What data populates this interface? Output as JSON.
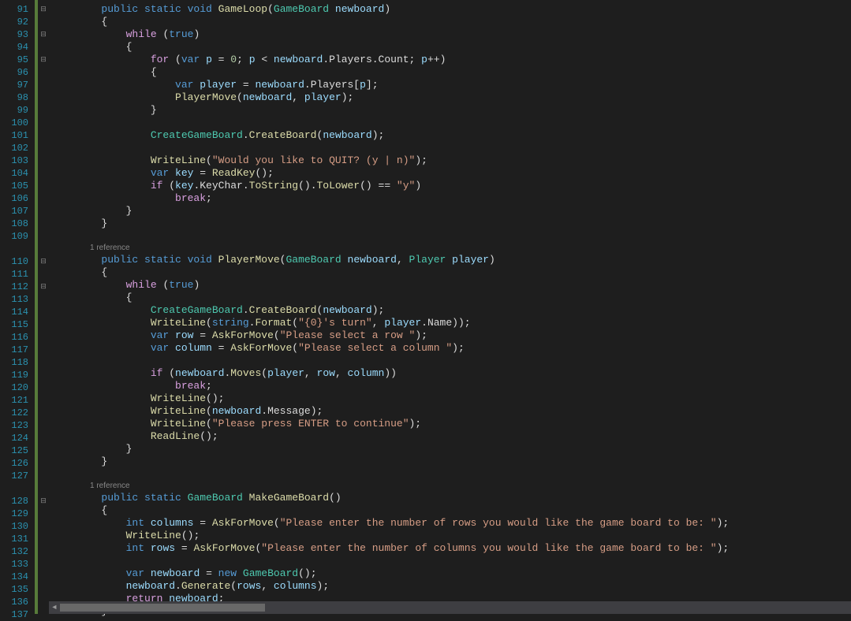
{
  "codelens": {
    "text": "1 reference"
  },
  "lines": {
    "91": {
      "tokens": [
        [
          "kw",
          "        public static void"
        ],
        [
          "plain",
          " "
        ],
        [
          "method",
          "GameLoop"
        ],
        [
          "plain",
          "("
        ],
        [
          "type",
          "GameBoard"
        ],
        [
          "plain",
          " "
        ],
        [
          "param",
          "newboard"
        ],
        [
          "plain",
          ")"
        ]
      ]
    },
    "92": {
      "tokens": [
        [
          "plain",
          "        {"
        ]
      ]
    },
    "93": {
      "tokens": [
        [
          "plain",
          "            "
        ],
        [
          "ctrl",
          "while"
        ],
        [
          "plain",
          " ("
        ],
        [
          "kw",
          "true"
        ],
        [
          "plain",
          ")"
        ]
      ]
    },
    "94": {
      "tokens": [
        [
          "plain",
          "            {"
        ]
      ]
    },
    "95": {
      "tokens": [
        [
          "plain",
          "                "
        ],
        [
          "ctrl",
          "for"
        ],
        [
          "plain",
          " ("
        ],
        [
          "kw",
          "var"
        ],
        [
          "plain",
          " "
        ],
        [
          "param",
          "p"
        ],
        [
          "plain",
          " = "
        ],
        [
          "num",
          "0"
        ],
        [
          "plain",
          "; "
        ],
        [
          "param",
          "p"
        ],
        [
          "plain",
          " < "
        ],
        [
          "param",
          "newboard"
        ],
        [
          "plain",
          ".Players.Count; "
        ],
        [
          "param",
          "p"
        ],
        [
          "plain",
          "++)"
        ]
      ]
    },
    "96": {
      "tokens": [
        [
          "plain",
          "                {"
        ]
      ]
    },
    "97": {
      "tokens": [
        [
          "plain",
          "                    "
        ],
        [
          "kw",
          "var"
        ],
        [
          "plain",
          " "
        ],
        [
          "param",
          "player"
        ],
        [
          "plain",
          " = "
        ],
        [
          "param",
          "newboard"
        ],
        [
          "plain",
          ".Players["
        ],
        [
          "param",
          "p"
        ],
        [
          "plain",
          "];"
        ]
      ]
    },
    "98": {
      "tokens": [
        [
          "plain",
          "                    "
        ],
        [
          "method",
          "PlayerMove"
        ],
        [
          "plain",
          "("
        ],
        [
          "param",
          "newboard"
        ],
        [
          "plain",
          ", "
        ],
        [
          "param",
          "player"
        ],
        [
          "plain",
          ");"
        ]
      ]
    },
    "99": {
      "tokens": [
        [
          "plain",
          "                }"
        ]
      ]
    },
    "100": {
      "tokens": [
        [
          "plain",
          ""
        ]
      ]
    },
    "101": {
      "tokens": [
        [
          "plain",
          "                "
        ],
        [
          "type",
          "CreateGameBoard"
        ],
        [
          "plain",
          "."
        ],
        [
          "method",
          "CreateBoard"
        ],
        [
          "plain",
          "("
        ],
        [
          "param",
          "newboard"
        ],
        [
          "plain",
          ");"
        ]
      ]
    },
    "102": {
      "tokens": [
        [
          "plain",
          ""
        ]
      ]
    },
    "103": {
      "tokens": [
        [
          "plain",
          "                "
        ],
        [
          "method",
          "WriteLine"
        ],
        [
          "plain",
          "("
        ],
        [
          "str",
          "\"Would you like to QUIT? (y | n)\""
        ],
        [
          "plain",
          ");"
        ]
      ]
    },
    "104": {
      "tokens": [
        [
          "plain",
          "                "
        ],
        [
          "kw",
          "var"
        ],
        [
          "plain",
          " "
        ],
        [
          "param",
          "key"
        ],
        [
          "plain",
          " = "
        ],
        [
          "method",
          "ReadKey"
        ],
        [
          "plain",
          "();"
        ]
      ]
    },
    "105": {
      "tokens": [
        [
          "plain",
          "                "
        ],
        [
          "ctrl",
          "if"
        ],
        [
          "plain",
          " ("
        ],
        [
          "param",
          "key"
        ],
        [
          "plain",
          ".KeyChar."
        ],
        [
          "method",
          "ToString"
        ],
        [
          "plain",
          "()."
        ],
        [
          "method",
          "ToLower"
        ],
        [
          "plain",
          "() == "
        ],
        [
          "str",
          "\"y\""
        ],
        [
          "plain",
          ")"
        ]
      ]
    },
    "106": {
      "tokens": [
        [
          "plain",
          "                    "
        ],
        [
          "ctrl",
          "break"
        ],
        [
          "plain",
          ";"
        ]
      ]
    },
    "107": {
      "tokens": [
        [
          "plain",
          "            }"
        ]
      ]
    },
    "108": {
      "tokens": [
        [
          "plain",
          "        }"
        ]
      ]
    },
    "109": {
      "tokens": [
        [
          "plain",
          ""
        ]
      ]
    },
    "110": {
      "tokens": [
        [
          "kw",
          "        public static void"
        ],
        [
          "plain",
          " "
        ],
        [
          "method",
          "PlayerMove"
        ],
        [
          "plain",
          "("
        ],
        [
          "type",
          "GameBoard"
        ],
        [
          "plain",
          " "
        ],
        [
          "param",
          "newboard"
        ],
        [
          "plain",
          ", "
        ],
        [
          "type",
          "Player"
        ],
        [
          "plain",
          " "
        ],
        [
          "param",
          "player"
        ],
        [
          "plain",
          ")"
        ]
      ]
    },
    "111": {
      "tokens": [
        [
          "plain",
          "        {"
        ]
      ]
    },
    "112": {
      "tokens": [
        [
          "plain",
          "            "
        ],
        [
          "ctrl",
          "while"
        ],
        [
          "plain",
          " ("
        ],
        [
          "kw",
          "true"
        ],
        [
          "plain",
          ")"
        ]
      ]
    },
    "113": {
      "tokens": [
        [
          "plain",
          "            {"
        ]
      ]
    },
    "114": {
      "tokens": [
        [
          "plain",
          "                "
        ],
        [
          "type",
          "CreateGameBoard"
        ],
        [
          "plain",
          "."
        ],
        [
          "method",
          "CreateBoard"
        ],
        [
          "plain",
          "("
        ],
        [
          "param",
          "newboard"
        ],
        [
          "plain",
          ");"
        ]
      ]
    },
    "115": {
      "tokens": [
        [
          "plain",
          "                "
        ],
        [
          "method",
          "WriteLine"
        ],
        [
          "plain",
          "("
        ],
        [
          "kw",
          "string"
        ],
        [
          "plain",
          "."
        ],
        [
          "method",
          "Format"
        ],
        [
          "plain",
          "("
        ],
        [
          "str",
          "\"{0}'s turn\""
        ],
        [
          "plain",
          ", "
        ],
        [
          "param",
          "player"
        ],
        [
          "plain",
          ".Name));"
        ]
      ]
    },
    "116": {
      "tokens": [
        [
          "plain",
          "                "
        ],
        [
          "kw",
          "var"
        ],
        [
          "plain",
          " "
        ],
        [
          "param",
          "row"
        ],
        [
          "plain",
          " = "
        ],
        [
          "method",
          "AskForMove"
        ],
        [
          "plain",
          "("
        ],
        [
          "str",
          "\"Please select a row \""
        ],
        [
          "plain",
          ");"
        ]
      ]
    },
    "117": {
      "tokens": [
        [
          "plain",
          "                "
        ],
        [
          "kw",
          "var"
        ],
        [
          "plain",
          " "
        ],
        [
          "param",
          "column"
        ],
        [
          "plain",
          " = "
        ],
        [
          "method",
          "AskForMove"
        ],
        [
          "plain",
          "("
        ],
        [
          "str",
          "\"Please select a column \""
        ],
        [
          "plain",
          ");"
        ]
      ]
    },
    "118": {
      "tokens": [
        [
          "plain",
          ""
        ]
      ]
    },
    "119": {
      "tokens": [
        [
          "plain",
          "                "
        ],
        [
          "ctrl",
          "if"
        ],
        [
          "plain",
          " ("
        ],
        [
          "param",
          "newboard"
        ],
        [
          "plain",
          "."
        ],
        [
          "method",
          "Moves"
        ],
        [
          "plain",
          "("
        ],
        [
          "param",
          "player"
        ],
        [
          "plain",
          ", "
        ],
        [
          "param",
          "row"
        ],
        [
          "plain",
          ", "
        ],
        [
          "param",
          "column"
        ],
        [
          "plain",
          "))"
        ]
      ]
    },
    "120": {
      "tokens": [
        [
          "plain",
          "                    "
        ],
        [
          "ctrl",
          "break"
        ],
        [
          "plain",
          ";"
        ]
      ]
    },
    "121": {
      "tokens": [
        [
          "plain",
          "                "
        ],
        [
          "method",
          "WriteLine"
        ],
        [
          "plain",
          "();"
        ]
      ]
    },
    "122": {
      "tokens": [
        [
          "plain",
          "                "
        ],
        [
          "method",
          "WriteLine"
        ],
        [
          "plain",
          "("
        ],
        [
          "param",
          "newboard"
        ],
        [
          "plain",
          ".Message);"
        ]
      ]
    },
    "123": {
      "tokens": [
        [
          "plain",
          "                "
        ],
        [
          "method",
          "WriteLine"
        ],
        [
          "plain",
          "("
        ],
        [
          "str",
          "\"Please press ENTER to continue\""
        ],
        [
          "plain",
          ");"
        ]
      ]
    },
    "124": {
      "tokens": [
        [
          "plain",
          "                "
        ],
        [
          "method",
          "ReadLine"
        ],
        [
          "plain",
          "();"
        ]
      ]
    },
    "125": {
      "tokens": [
        [
          "plain",
          "            }"
        ]
      ]
    },
    "126": {
      "tokens": [
        [
          "plain",
          "        }"
        ]
      ]
    },
    "127": {
      "tokens": [
        [
          "plain",
          ""
        ]
      ]
    },
    "128": {
      "tokens": [
        [
          "kw",
          "        public static"
        ],
        [
          "plain",
          " "
        ],
        [
          "type",
          "GameBoard"
        ],
        [
          "plain",
          " "
        ],
        [
          "method",
          "MakeGameBoard"
        ],
        [
          "plain",
          "()"
        ]
      ]
    },
    "129": {
      "tokens": [
        [
          "plain",
          "        {"
        ]
      ]
    },
    "130": {
      "tokens": [
        [
          "plain",
          "            "
        ],
        [
          "kw",
          "int"
        ],
        [
          "plain",
          " "
        ],
        [
          "param",
          "columns"
        ],
        [
          "plain",
          " = "
        ],
        [
          "method",
          "AskForMove"
        ],
        [
          "plain",
          "("
        ],
        [
          "str",
          "\"Please enter the number of rows you would like the game board to be: \""
        ],
        [
          "plain",
          ");"
        ]
      ]
    },
    "131": {
      "tokens": [
        [
          "plain",
          "            "
        ],
        [
          "method",
          "WriteLine"
        ],
        [
          "plain",
          "();"
        ]
      ]
    },
    "132": {
      "tokens": [
        [
          "plain",
          "            "
        ],
        [
          "kw",
          "int"
        ],
        [
          "plain",
          " "
        ],
        [
          "param",
          "rows"
        ],
        [
          "plain",
          " = "
        ],
        [
          "method",
          "AskForMove"
        ],
        [
          "plain",
          "("
        ],
        [
          "str",
          "\"Please enter the number of columns you would like the game board to be: \""
        ],
        [
          "plain",
          ");"
        ]
      ]
    },
    "133": {
      "tokens": [
        [
          "plain",
          ""
        ]
      ]
    },
    "134": {
      "tokens": [
        [
          "plain",
          "            "
        ],
        [
          "kw",
          "var"
        ],
        [
          "plain",
          " "
        ],
        [
          "param",
          "newboard"
        ],
        [
          "plain",
          " = "
        ],
        [
          "kw",
          "new"
        ],
        [
          "plain",
          " "
        ],
        [
          "type",
          "GameBoard"
        ],
        [
          "plain",
          "();"
        ]
      ]
    },
    "135": {
      "tokens": [
        [
          "plain",
          "            "
        ],
        [
          "param",
          "newboard"
        ],
        [
          "plain",
          "."
        ],
        [
          "method",
          "Generate"
        ],
        [
          "plain",
          "("
        ],
        [
          "param",
          "rows"
        ],
        [
          "plain",
          ", "
        ],
        [
          "param",
          "columns"
        ],
        [
          "plain",
          ");"
        ]
      ]
    },
    "136": {
      "tokens": [
        [
          "plain",
          "            "
        ],
        [
          "ctrl",
          "return"
        ],
        [
          "plain",
          " "
        ],
        [
          "param",
          "newboard"
        ],
        [
          "plain",
          ";"
        ]
      ]
    },
    "137": {
      "tokens": [
        [
          "plain",
          "        }"
        ]
      ]
    }
  },
  "fold_marks": {
    "91": "⊟",
    "93": "⊟",
    "95": "⊟",
    "110": "⊟",
    "112": "⊟",
    "128": "⊟"
  },
  "line_order": [
    "91",
    "92",
    "93",
    "94",
    "95",
    "96",
    "97",
    "98",
    "99",
    "100",
    "101",
    "102",
    "103",
    "104",
    "105",
    "106",
    "107",
    "108",
    "109",
    "ref1",
    "110",
    "111",
    "112",
    "113",
    "114",
    "115",
    "116",
    "117",
    "118",
    "119",
    "120",
    "121",
    "122",
    "123",
    "124",
    "125",
    "126",
    "127",
    "ref2",
    "128",
    "129",
    "130",
    "131",
    "132",
    "133",
    "134",
    "135",
    "136",
    "137"
  ]
}
